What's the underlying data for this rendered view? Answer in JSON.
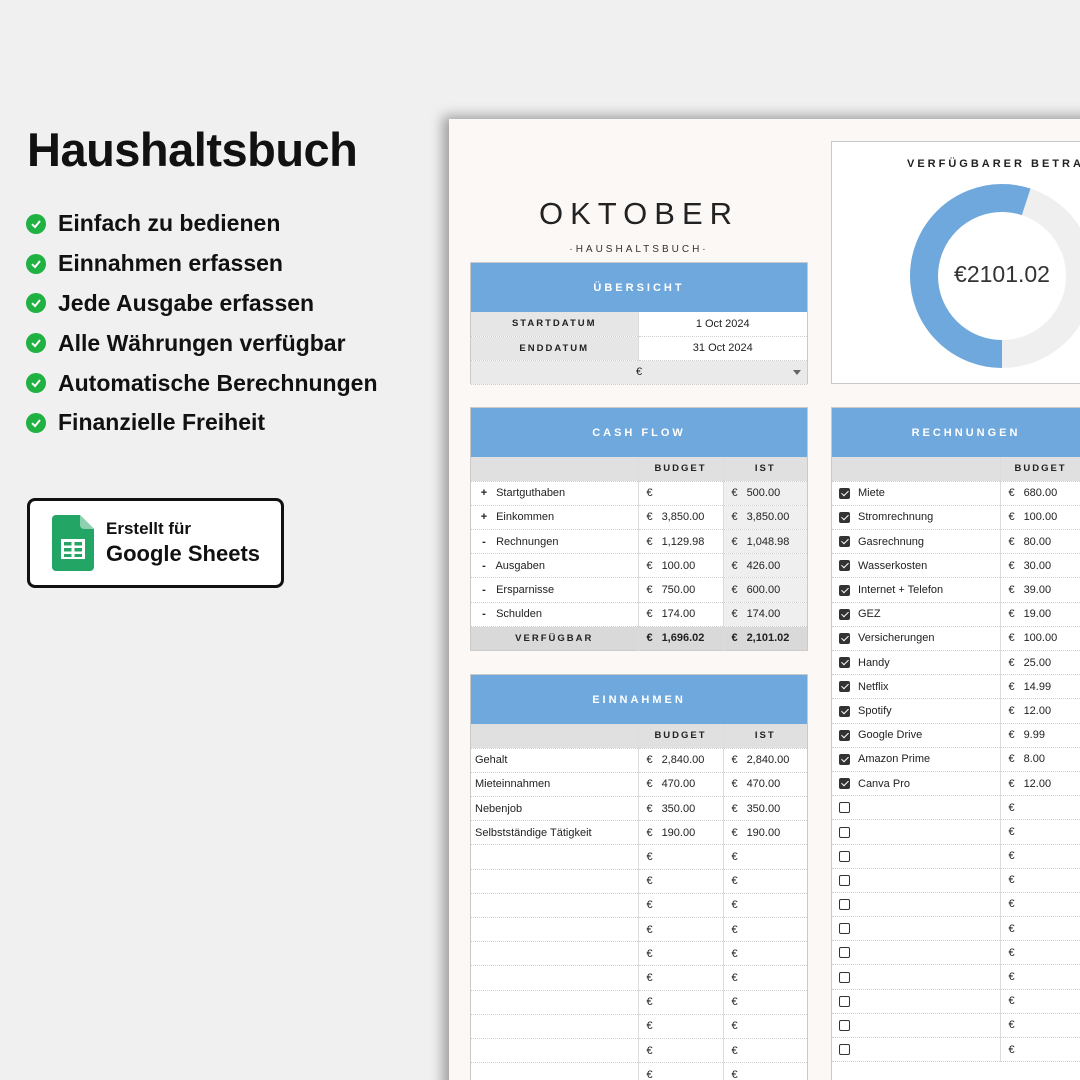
{
  "promo": {
    "title": "Haushaltsbuch",
    "features": [
      "Einfach zu bedienen",
      "Einnahmen erfassen",
      "Jede Ausgabe erfassen",
      "Alle Währungen verfügbar",
      "Automatische Berechnungen",
      "Finanzielle Freiheit"
    ],
    "badge_line1": "Erstellt für",
    "badge_line2": "Google Sheets"
  },
  "sheet": {
    "month": "OKTOBER",
    "subtitle": "·HAUSHALTSBUCH·",
    "overview": {
      "header": "ÜBERSICHT",
      "start_label": "STARTDATUM",
      "start_value": "1 Oct 2024",
      "end_label": "ENDDATUM",
      "end_value": "31 Oct 2024",
      "currency": "€"
    },
    "available": {
      "label": "VERFÜGBARER BETRA",
      "value": "€2101.02",
      "fraction": 0.55,
      "color": "#6fa8dc",
      "track_color": "#efefef"
    },
    "cashflow": {
      "header": "CASH FLOW",
      "col_budget": "BUDGET",
      "col_actual": "IST",
      "rows": [
        {
          "sign": "+",
          "label": "Startguthaben",
          "cur1": "€",
          "budget": "",
          "cur2": "€",
          "actual": "500.00"
        },
        {
          "sign": "+",
          "label": "Einkommen",
          "cur1": "€",
          "budget": "3,850.00",
          "cur2": "€",
          "actual": "3,850.00"
        },
        {
          "sign": "-",
          "label": "Rechnungen",
          "cur1": "€",
          "budget": "1,129.98",
          "cur2": "€",
          "actual": "1,048.98"
        },
        {
          "sign": "-",
          "label": "Ausgaben",
          "cur1": "€",
          "budget": "100.00",
          "cur2": "€",
          "actual": "426.00"
        },
        {
          "sign": "-",
          "label": "Ersparnisse",
          "cur1": "€",
          "budget": "750.00",
          "cur2": "€",
          "actual": "600.00"
        },
        {
          "sign": "-",
          "label": "Schulden",
          "cur1": "€",
          "budget": "174.00",
          "cur2": "€",
          "actual": "174.00"
        }
      ],
      "total_label": "VERFÜGBAR",
      "total_cur1": "€",
      "total_budget": "1,696.02",
      "total_cur2": "€",
      "total_actual": "2,101.02"
    },
    "income": {
      "header": "EINNAHMEN",
      "col_budget": "BUDGET",
      "col_actual": "IST",
      "rows": [
        {
          "label": "Gehalt",
          "cur1": "€",
          "budget": "2,840.00",
          "cur2": "€",
          "actual": "2,840.00"
        },
        {
          "label": "Mieteinnahmen",
          "cur1": "€",
          "budget": "470.00",
          "cur2": "€",
          "actual": "470.00"
        },
        {
          "label": "Nebenjob",
          "cur1": "€",
          "budget": "350.00",
          "cur2": "€",
          "actual": "350.00"
        },
        {
          "label": "Selbstständige Tätigkeit",
          "cur1": "€",
          "budget": "190.00",
          "cur2": "€",
          "actual": "190.00"
        },
        {
          "label": "",
          "cur1": "€",
          "budget": "",
          "cur2": "€",
          "actual": ""
        },
        {
          "label": "",
          "cur1": "€",
          "budget": "",
          "cur2": "€",
          "actual": ""
        },
        {
          "label": "",
          "cur1": "€",
          "budget": "",
          "cur2": "€",
          "actual": ""
        },
        {
          "label": "",
          "cur1": "€",
          "budget": "",
          "cur2": "€",
          "actual": ""
        },
        {
          "label": "",
          "cur1": "€",
          "budget": "",
          "cur2": "€",
          "actual": ""
        },
        {
          "label": "",
          "cur1": "€",
          "budget": "",
          "cur2": "€",
          "actual": ""
        },
        {
          "label": "",
          "cur1": "€",
          "budget": "",
          "cur2": "€",
          "actual": ""
        },
        {
          "label": "",
          "cur1": "€",
          "budget": "",
          "cur2": "€",
          "actual": ""
        },
        {
          "label": "",
          "cur1": "€",
          "budget": "",
          "cur2": "€",
          "actual": ""
        },
        {
          "label": "",
          "cur1": "€",
          "budget": "",
          "cur2": "€",
          "actual": ""
        }
      ]
    },
    "bills": {
      "header": "RECHNUNGEN",
      "col_budget": "BUDGET",
      "rows": [
        {
          "checked": true,
          "label": "Miete",
          "cur": "€",
          "budget": "680.00"
        },
        {
          "checked": true,
          "label": "Stromrechnung",
          "cur": "€",
          "budget": "100.00"
        },
        {
          "checked": true,
          "label": "Gasrechnung",
          "cur": "€",
          "budget": "80.00"
        },
        {
          "checked": true,
          "label": "Wasserkosten",
          "cur": "€",
          "budget": "30.00"
        },
        {
          "checked": true,
          "label": "Internet + Telefon",
          "cur": "€",
          "budget": "39.00"
        },
        {
          "checked": true,
          "label": "GEZ",
          "cur": "€",
          "budget": "19.00"
        },
        {
          "checked": true,
          "label": "Versicherungen",
          "cur": "€",
          "budget": "100.00"
        },
        {
          "checked": true,
          "label": "Handy",
          "cur": "€",
          "budget": "25.00"
        },
        {
          "checked": true,
          "label": "Netflix",
          "cur": "€",
          "budget": "14.99"
        },
        {
          "checked": true,
          "label": "Spotify",
          "cur": "€",
          "budget": "12.00"
        },
        {
          "checked": true,
          "label": "Google Drive",
          "cur": "€",
          "budget": "9.99"
        },
        {
          "checked": true,
          "label": "Amazon Prime",
          "cur": "€",
          "budget": "8.00"
        },
        {
          "checked": true,
          "label": "Canva Pro",
          "cur": "€",
          "budget": "12.00"
        },
        {
          "checked": false,
          "label": "",
          "cur": "€",
          "budget": ""
        },
        {
          "checked": false,
          "label": "",
          "cur": "€",
          "budget": ""
        },
        {
          "checked": false,
          "label": "",
          "cur": "€",
          "budget": ""
        },
        {
          "checked": false,
          "label": "",
          "cur": "€",
          "budget": ""
        },
        {
          "checked": false,
          "label": "",
          "cur": "€",
          "budget": ""
        },
        {
          "checked": false,
          "label": "",
          "cur": "€",
          "budget": ""
        },
        {
          "checked": false,
          "label": "",
          "cur": "€",
          "budget": ""
        },
        {
          "checked": false,
          "label": "",
          "cur": "€",
          "budget": ""
        },
        {
          "checked": false,
          "label": "",
          "cur": "€",
          "budget": ""
        },
        {
          "checked": false,
          "label": "",
          "cur": "€",
          "budget": ""
        },
        {
          "checked": false,
          "label": "",
          "cur": "€",
          "budget": ""
        }
      ]
    }
  }
}
